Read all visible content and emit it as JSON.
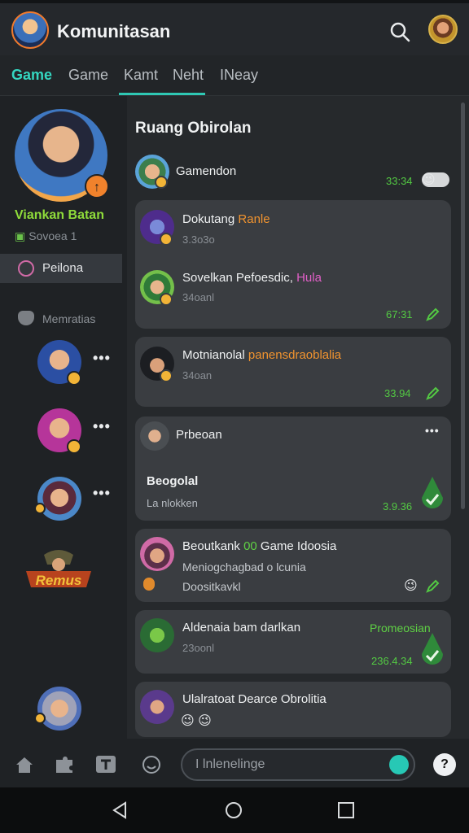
{
  "app": {
    "title": "Komunitasan"
  },
  "tabs": [
    {
      "label": "Game",
      "active": true
    },
    {
      "label": "Game",
      "active": false
    },
    {
      "label": "Kamt",
      "active": false
    },
    {
      "label": "Neht",
      "active": false
    },
    {
      "label": "INeay",
      "active": false
    }
  ],
  "profile": {
    "name": "Viankan Batan",
    "status": "Sovoea 1",
    "badge": "↑"
  },
  "sidebar": {
    "active_item": "Peilona",
    "members_label": "Memratias",
    "promo_logo_text": "Remus",
    "more_glyph": "•••"
  },
  "chat": {
    "room_title": "Ruang Obirolan",
    "messages": [
      {
        "name": "Gamendon",
        "time": "33:34",
        "emoji": "😉"
      },
      {
        "name": "Dokutang",
        "name_highlight": "Ranle",
        "sub": "3.3o3o"
      },
      {
        "name": "Sovelkan Pefoesdic,",
        "name_highlight": "Hula",
        "sub": "34oanl",
        "time": "67:31"
      },
      {
        "name": "Motnianolal",
        "name_highlight": "panensdraoblalia",
        "sub": "34oan",
        "time": "33.94"
      },
      {
        "name": "Prbeoan",
        "body": "Beogolal",
        "sub": "La nlokken",
        "time": "3.9.36"
      },
      {
        "name": "Beoutkank",
        "badge": "00",
        "name_rest": "Game Idoosia",
        "body": "Meniogchagbad o lcunia",
        "sub": "Doositkavkl",
        "emoji": "😉"
      },
      {
        "name": "Aldenaia bam darlkan",
        "tag": "Promeosian",
        "sub": "23oonl",
        "time": "236.4.34"
      },
      {
        "name": "Ulalratoat Dearce Obrolitia",
        "emoji": "😉 😉"
      }
    ]
  },
  "composer": {
    "placeholder": "I lnlenelinge"
  },
  "colors": {
    "accent": "#2fc8b4",
    "name_green": "#8fdc3a",
    "time_green": "#53c943",
    "orange": "#f0932f"
  }
}
